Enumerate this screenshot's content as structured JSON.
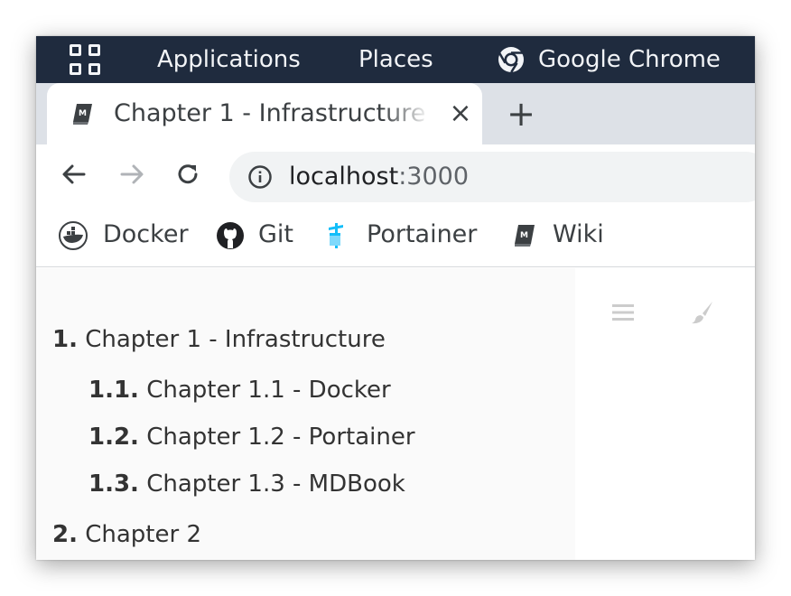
{
  "topbar": {
    "activities_icon": "app-grid-icon",
    "menus": [
      "Applications",
      "Places"
    ],
    "app_name": "Google Chrome",
    "app_icon": "chrome-icon"
  },
  "tab": {
    "title": "Chapter 1 - Infrastructure",
    "favicon": "book-icon",
    "close_label": "×"
  },
  "newtab_label": "+",
  "toolbar": {
    "back_icon": "back-arrow-icon",
    "forward_icon": "forward-arrow-icon",
    "reload_icon": "reload-icon",
    "url_host": "localhost",
    "url_port": ":3000",
    "info_icon": "info-icon"
  },
  "bookmarks": [
    {
      "label": "Docker",
      "icon": "docker-icon"
    },
    {
      "label": "Git",
      "icon": "github-icon"
    },
    {
      "label": "Portainer",
      "icon": "portainer-icon"
    },
    {
      "label": "Wiki",
      "icon": "book-icon"
    }
  ],
  "toc": [
    {
      "number": "1.",
      "label": " Chapter 1 - Infrastructure"
    },
    {
      "number": "1.1.",
      "label": " Chapter 1.1 - Docker"
    },
    {
      "number": "1.2.",
      "label": " Chapter 1.2 - Portainer"
    },
    {
      "number": "1.3.",
      "label": " Chapter 1.3 - MDBook"
    },
    {
      "number": "2.",
      "label": " Chapter 2"
    }
  ],
  "menu_bar_icons": [
    "hamburger-menu-icon",
    "paintbrush-icon"
  ],
  "colors": {
    "topbar_bg": "#1f2b3e",
    "tabstrip_bg": "#dde1e7",
    "sidebar_bg": "#fafafa",
    "omnibox_bg": "#f1f3f4"
  }
}
